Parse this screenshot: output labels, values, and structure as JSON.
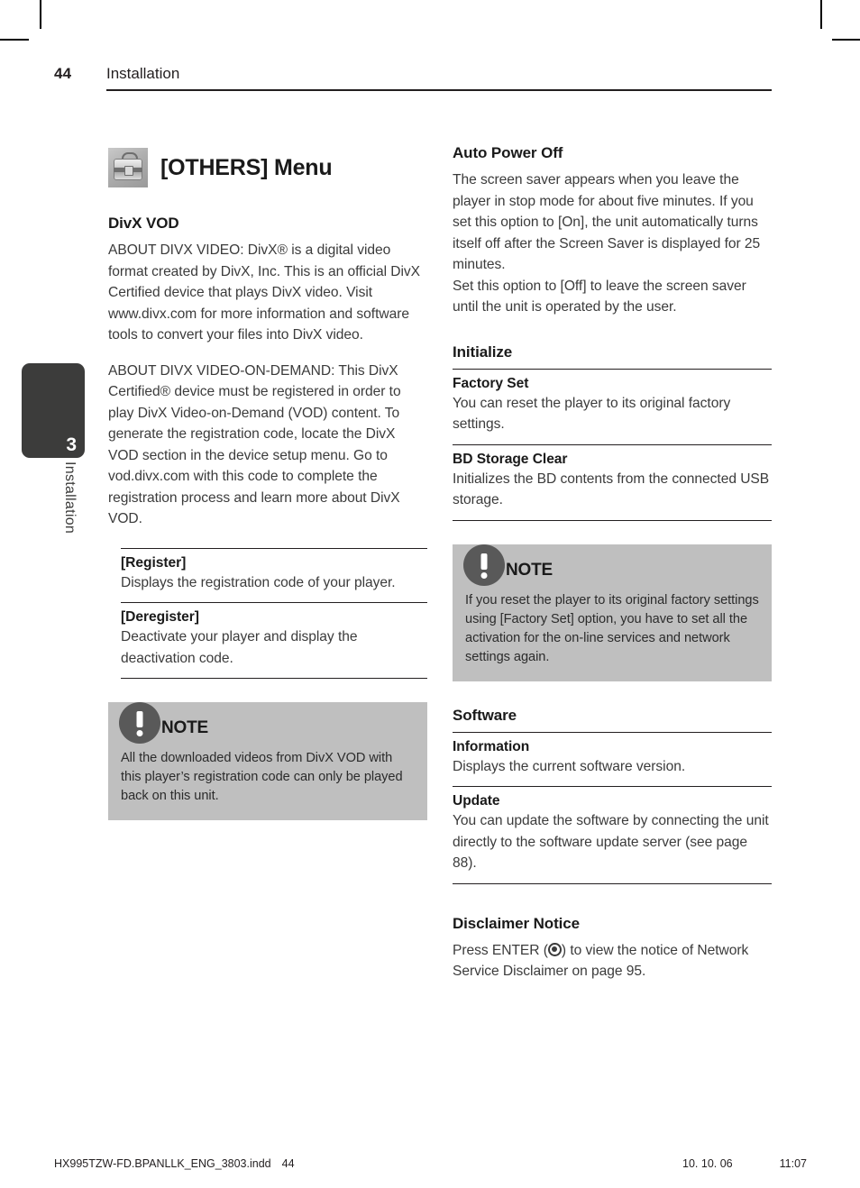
{
  "cropmarks": {
    "present": true
  },
  "runhead": {
    "page_number": "44",
    "title": "Installation"
  },
  "chapter_tab": {
    "number": "3",
    "label": "Installation"
  },
  "left_column": {
    "menu": {
      "icon": "toolbox-icon",
      "title": "[OTHERS] Menu"
    },
    "divx_vod": {
      "heading": "DivX VOD",
      "paragraphs": [
        "ABOUT DIVX VIDEO: DivX® is a digital video format created by DivX, Inc. This is an official DivX Certified device that plays DivX video. Visit www.divx.com for more information and software tools to convert your files into DivX video.",
        "ABOUT DIVX VIDEO-ON-DEMAND: This DivX Certified® device must be registered in order to play DivX Video-on-Demand (VOD) content. To generate the registration code, locate the DivX VOD section in the device setup menu. Go to vod.divx.com with this code to complete the registration process and learn more about DivX VOD."
      ],
      "items": [
        {
          "title": "[Register]",
          "desc": "Displays the registration code of your player."
        },
        {
          "title": "[Deregister]",
          "desc": "Deactivate your player and display the deactivation code."
        }
      ]
    },
    "note": {
      "icon": "exclamation-icon",
      "label": "NOTE",
      "text": "All the downloaded videos from DivX VOD with this player’s registration code can only be played back on this unit."
    }
  },
  "right_column": {
    "auto_power_off": {
      "heading": "Auto Power Off",
      "paragraph": "The screen saver appears when you leave the player in stop mode for about five minutes. If you set this option to [On], the unit automatically turns itself off after the Screen Saver is displayed for 25 minutes.\nSet this option to [Off] to leave the screen saver until the unit is operated by the user."
    },
    "initialize": {
      "heading": "Initialize",
      "items": [
        {
          "title": "Factory Set",
          "desc": "You can reset the player to its original factory settings."
        },
        {
          "title": "BD Storage Clear",
          "desc": "Initializes the BD contents from the connected USB storage."
        }
      ]
    },
    "note": {
      "icon": "exclamation-icon",
      "label": "NOTE",
      "text": "If you reset the player to its original factory settings using [Factory Set] option, you have to set all the activation for the on-line services and network settings again."
    },
    "software": {
      "heading": "Software",
      "items": [
        {
          "title": "Information",
          "desc": "Displays the current software version."
        },
        {
          "title": "Update",
          "desc": "You can update the software by connecting the unit directly to the software update server (see page 88)."
        }
      ]
    },
    "disclaimer": {
      "heading": "Disclaimer Notice",
      "text_before": "Press ENTER (",
      "icon": "enter-button-icon",
      "text_after": ") to view the notice of Network Service Disclaimer on page 95."
    }
  },
  "footer": {
    "file_name": "HX995TZW-FD.BPANLLK_ENG_3803.indd",
    "page_number": "44",
    "date": "10. 10. 06",
    "time": "11:07"
  },
  "colors": {
    "text": "#231f20",
    "body_text": "#3b3b3b",
    "note_background": "#bfbfbf",
    "note_bubble": "#595959",
    "chapter_tab": "#3c3c3b",
    "rule": "#231f20"
  }
}
